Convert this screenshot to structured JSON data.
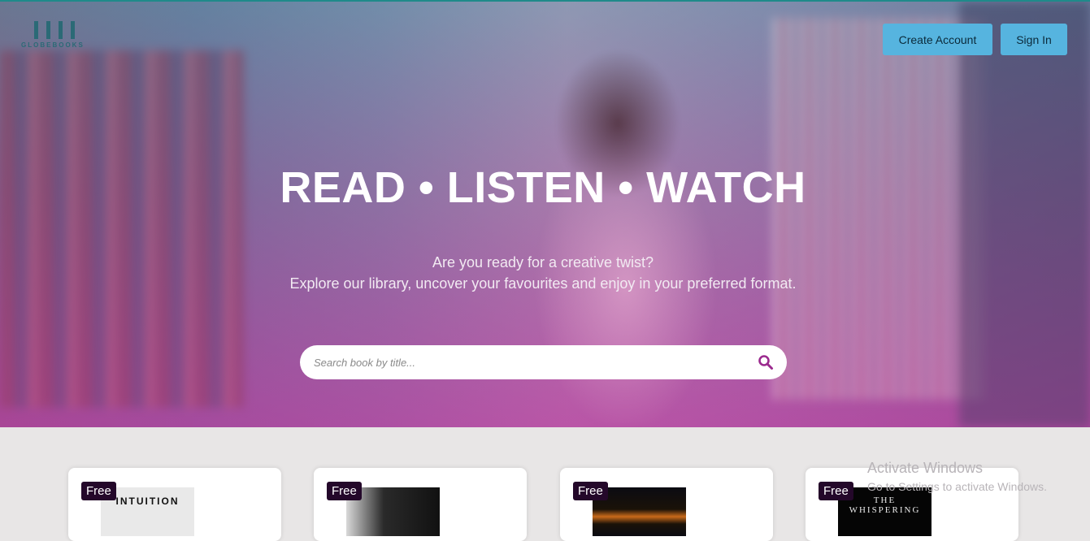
{
  "brand": {
    "logo_text": "GLOBEBOOKS"
  },
  "header": {
    "create_account_label": "Create Account",
    "sign_in_label": "Sign In"
  },
  "hero": {
    "headline": "READ • LISTEN • WATCH",
    "subtitle_line1": "Are you ready for a creative twist?",
    "subtitle_line2": "Explore our library, uncover your favourites and enjoy in your preferred format.",
    "search_placeholder": "Search book by title...",
    "search_icon": "search-icon"
  },
  "books": [
    {
      "badge": "Free",
      "cover_title": "INTUITION"
    },
    {
      "badge": "Free",
      "cover_title": ""
    },
    {
      "badge": "Free",
      "cover_title": ""
    },
    {
      "badge": "Free",
      "cover_title": "THE WHISPERING"
    }
  ],
  "watermark": {
    "line1": "Activate Windows",
    "line2": "Go to Settings to activate Windows."
  },
  "colors": {
    "accent_button": "#56b4df",
    "badge_bg": "#24082a",
    "search_icon": "#9b2a8e",
    "topline": "#1f8a8a"
  }
}
